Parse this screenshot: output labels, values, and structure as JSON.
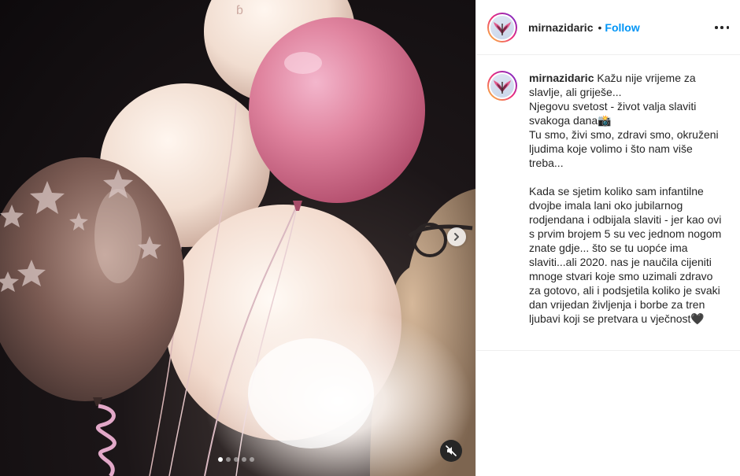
{
  "post": {
    "username": "mirnazidaric",
    "separator": "•",
    "follow_label": "Follow",
    "more_icon": "more-options-icon"
  },
  "media": {
    "carousel_dots": 5,
    "active_dot": 0,
    "next_icon": "chevron-right-icon",
    "mute_icon": "muted-speaker-icon"
  },
  "caption": {
    "username": "mirnazidaric",
    "line_1": "Kažu nije vrijeme za slavlje, ali griješe...",
    "line_2": "Njegovu svetost - život valja slaviti svakoga dana📸",
    "line_3": "Tu smo, živi smo, zdravi smo, okruženi ljudima koje volimo i što nam više treba...",
    "line_4": "Kada se sjetim koliko sam infantilne dvojbe imala lani oko jubilarnog rodjendana i odbijala slaviti - jer kao ovi s prvim brojem 5 su vec jednom nogom znate gdje... što se tu uopće ima slaviti...ali 2020. nas je naučila cijeniti mnoge stvari koje smo uzimali zdravo za gotovo, ali i podsjetila koliko je svaki dan vrijedan življenja i borbe za tren ljubavi koji se pretvara u vječnost🖤"
  }
}
